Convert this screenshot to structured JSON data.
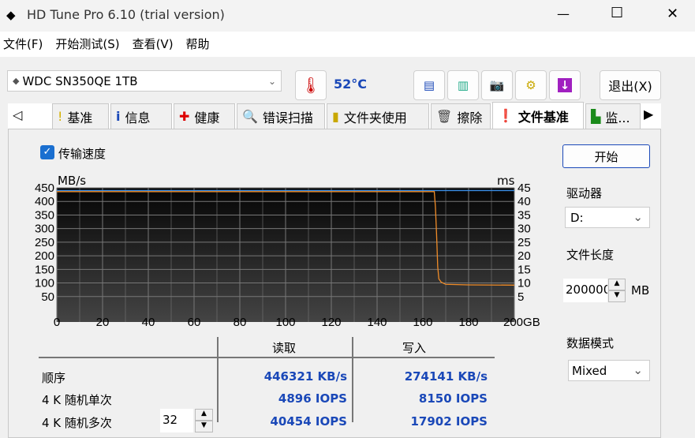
{
  "window": {
    "title": "HD Tune Pro 6.10 (trial version)",
    "minimize": "—",
    "maximize": "☐",
    "close": "✕"
  },
  "menu": [
    "文件(F)",
    "开始测试(S)",
    "查看(V)",
    "帮助"
  ],
  "toolbar": {
    "drive": "WDC SN350QE 1TB",
    "temperature": "52°C",
    "exit_label": "退出(X)"
  },
  "tabs": [
    {
      "label": "基准",
      "icon": "exclamation-icon"
    },
    {
      "label": "信息",
      "icon": "info-icon"
    },
    {
      "label": "健康",
      "icon": "red-cross-icon"
    },
    {
      "label": "错误扫描",
      "icon": "magnifier-icon"
    },
    {
      "label": "文件夹使用",
      "icon": "folder-icon"
    },
    {
      "label": "擦除",
      "icon": "trash-icon"
    },
    {
      "label": "文件基准",
      "icon": "file-benchmark-icon",
      "active": true
    },
    {
      "label": "监...",
      "icon": "monitor-chart-icon"
    }
  ],
  "options": {
    "transfer_speed_label": "传输速度",
    "transfer_speed_checked": true
  },
  "side": {
    "start_label": "开始",
    "drive_label": "驱动器",
    "drive_value": "D:",
    "file_length_label": "文件长度",
    "file_length_value": "200000",
    "file_length_unit": "MB",
    "data_mode_label": "数据模式",
    "data_mode_value": "Mixed"
  },
  "chart_data": {
    "type": "line",
    "ylabel_left": "MB/s",
    "ylabel_right": "ms",
    "x_unit": "GB",
    "xlim": [
      0,
      200
    ],
    "ylim_left": [
      0,
      450
    ],
    "ylim_right": [
      0,
      45
    ],
    "x_ticks": [
      "0",
      "20",
      "40",
      "60",
      "80",
      "100",
      "120",
      "140",
      "160",
      "180",
      "200GB"
    ],
    "y_ticks_left": [
      "450",
      "400",
      "350",
      "300",
      "250",
      "200",
      "150",
      "100",
      "50"
    ],
    "y_ticks_right": [
      "45",
      "40",
      "35",
      "30",
      "25",
      "20",
      "15",
      "10",
      "5"
    ],
    "grid": true,
    "series": [
      {
        "color": "#3a8ee6",
        "x": [
          0,
          200
        ],
        "y": [
          440,
          440
        ]
      },
      {
        "color": "#f08c28",
        "x": [
          0,
          165,
          165.5,
          166,
          166.5,
          167,
          168,
          170,
          180,
          200
        ],
        "y": [
          436,
          436,
          380,
          280,
          160,
          115,
          103,
          95,
          93,
          92
        ]
      }
    ]
  },
  "results": {
    "headers": [
      "读取",
      "写入"
    ],
    "rows": [
      {
        "label": "顺序",
        "read": "446321 KB/s",
        "write": "274141 KB/s"
      },
      {
        "label": "4 K 随机单次",
        "read": "4896 IOPS",
        "write": "8150 IOPS"
      },
      {
        "label": "4 K 随机多次",
        "read": "40454 IOPS",
        "write": "17902 IOPS"
      }
    ],
    "queue_depth": "32"
  },
  "colors": {
    "read": "#3a8ee6",
    "write": "#f08c28",
    "value_text": "#1a48b8"
  }
}
